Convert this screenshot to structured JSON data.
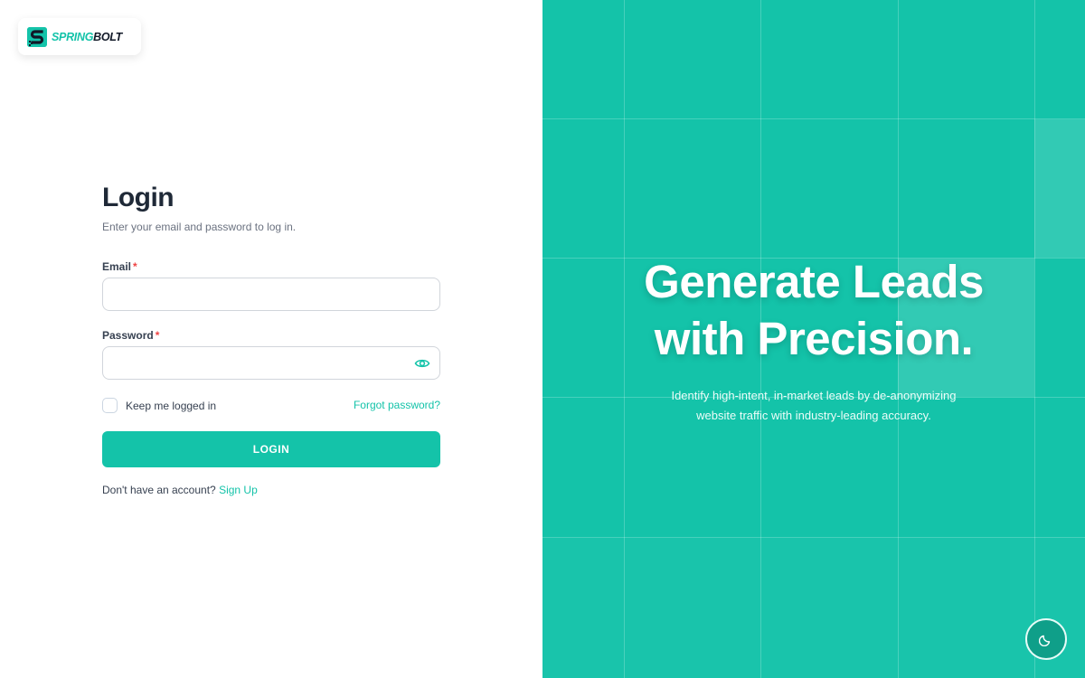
{
  "brand": {
    "name_part1": "SPRING",
    "name_part2": "BOLT",
    "icon": "springbolt-logo-icon",
    "color": "#14c3a9"
  },
  "login": {
    "title": "Login",
    "subtitle": "Enter your email and password to log in.",
    "email": {
      "label": "Email",
      "required_mark": "*",
      "value": "",
      "placeholder": ""
    },
    "password": {
      "label": "Password",
      "required_mark": "*",
      "value": "",
      "placeholder": "",
      "toggle_icon": "eye-icon"
    },
    "remember_label": "Keep me logged in",
    "remember_checked": false,
    "forgot_label": "Forgot password?",
    "submit_label": "LOGIN",
    "signup_prompt": "Don't have an account?",
    "signup_label": "Sign Up"
  },
  "hero": {
    "headline_line1": "Generate Leads",
    "headline_line2": "with Precision.",
    "tagline": "Identify high-intent, in-market leads by de-anonymizing website traffic with industry-leading accuracy.",
    "background_color": "#14c3a9"
  },
  "theme_toggle": {
    "icon": "moon-icon"
  }
}
